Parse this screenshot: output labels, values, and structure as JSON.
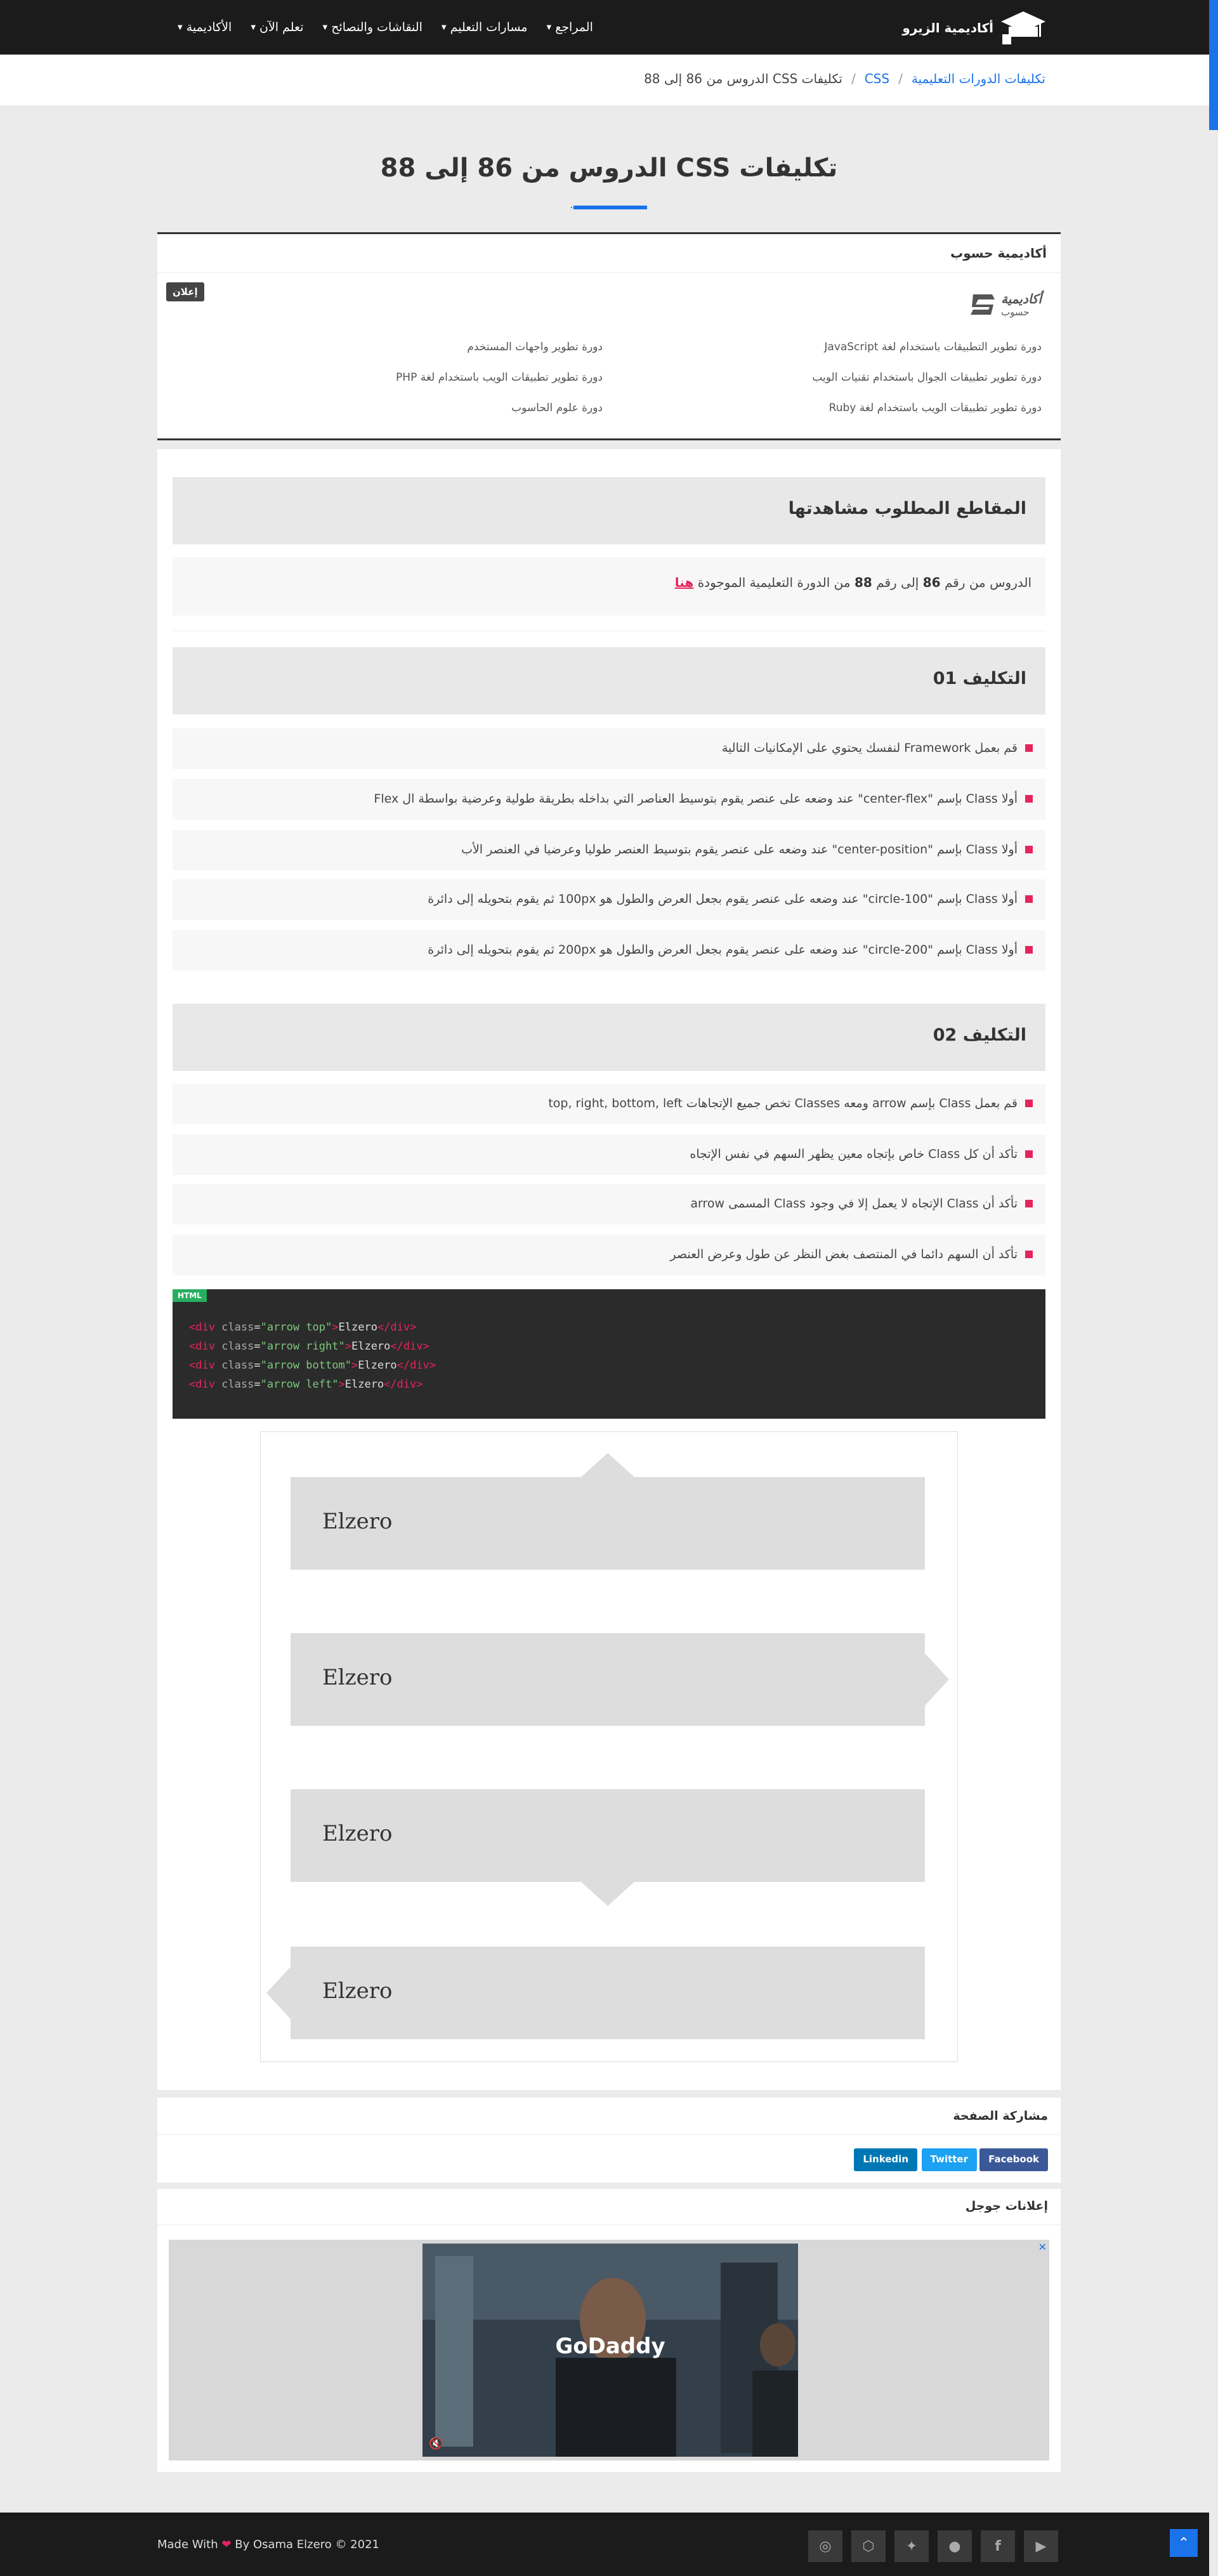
{
  "nav": {
    "logo": "أكاديمية الزيرو",
    "menu": [
      "الأكاديمية",
      "تعلم الآن",
      "النقاشات والنصائح",
      "مسارات التعليم",
      "المراجع"
    ]
  },
  "breadcrumb": {
    "root": "تكليفات الدورات التعليمية",
    "cat": "CSS",
    "current": "تكليفات CSS الدروس من 86 إلى 88"
  },
  "page_title": "تكليفات CSS الدروس من 86 إلى 88",
  "hasoub": {
    "title": "أكاديمية حسوب",
    "ad_label": "إعلان",
    "logo_main": "أكاديمية",
    "logo_sub": "حسوب",
    "courses": [
      "دورة تطوير التطبيقات باستخدام لغة JavaScript",
      "دورة تطوير واجهات المستخدم",
      "دورة تطوير تطبيقات الجوال باستخدام تقنيات الويب",
      "دورة تطوير تطبيقات الويب باستخدام لغة PHP",
      "دورة تطوير تطبيقات الويب باستخدام لغة Ruby",
      "دورة علوم الحاسوب"
    ]
  },
  "watch": {
    "title": "المقاطع المطلوب مشاهدتها",
    "text_a": "الدروس من رقم",
    "from": "86",
    "text_b": "إلى رقم",
    "to": "88",
    "text_c": "من الدورة التعليمية الموجودة",
    "link": "هنا"
  },
  "task1": {
    "title": "التكليف 01",
    "items": [
      "قم بعمل Framework لنفسك يحتوي على الإمكانيات التالية",
      "أولا Class بإسم \"center-flex\" عند وضعه على عنصر يقوم بتوسيط العناصر التي بداخله بطريقة طولية وعرضية بواسطة ال Flex",
      "أولا Class بإسم \"center-position\" عند وضعه على عنصر يقوم بتوسيط العنصر طوليا وعرضيا في العنصر الأب",
      "أولا Class بإسم \"circle-100\" عند وضعه على عنصر يقوم بجعل العرض والطول هو 100px ثم يقوم بتحويله إلى دائرة",
      "أولا Class بإسم \"circle-200\" عند وضعه على عنصر يقوم بجعل العرض والطول هو 200px ثم يقوم بتحويله إلى دائرة"
    ]
  },
  "task2": {
    "title": "التكليف 02",
    "items": [
      "قم بعمل Class بإسم arrow ومعه Classes تخص جميع الإتجاهات top, right, bottom, left",
      "تأكد أن كل Class خاص بإتجاه معين يظهر السهم في نفس الإتجاه",
      "تأكد أن Class الإتجاه لا يعمل إلا في وجود Class المسمى arrow",
      "تأكد أن السهم دائما في المنتصف بغض النظر عن طول وعرض العنصر"
    ]
  },
  "code": {
    "lang": "HTML",
    "lines": [
      {
        "cls": "arrow top",
        "text": "Elzero"
      },
      {
        "cls": "arrow right",
        "text": "Elzero"
      },
      {
        "cls": "arrow bottom",
        "text": "Elzero"
      },
      {
        "cls": "arrow left",
        "text": "Elzero"
      }
    ]
  },
  "demo": {
    "boxes": [
      {
        "label": "Elzero",
        "dir": "top"
      },
      {
        "label": "Elzero",
        "dir": "right"
      },
      {
        "label": "Elzero",
        "dir": "bottom"
      },
      {
        "label": "Elzero",
        "dir": "left"
      }
    ]
  },
  "share": {
    "title": "مشاركة الصفحة",
    "buttons": [
      {
        "label": "Facebook",
        "color": "#3b5998"
      },
      {
        "label": "Twitter",
        "color": "#1da1f2"
      },
      {
        "label": "Linkedin",
        "color": "#0077b5"
      }
    ]
  },
  "google_ads": {
    "title": "إعلانات جوجل",
    "video_brand": "GoDaddy",
    "close": "✕"
  },
  "footer": {
    "made_with": "Made With",
    "by": "By Osama Elzero © 2021",
    "social": [
      "youtube-icon",
      "facebook-icon",
      "github-icon",
      "twitter-icon",
      "codepen-icon",
      "instagram-icon"
    ]
  },
  "colors": {
    "accent": "#1a73e8",
    "pink": "#e6245c",
    "dark": "#1b1b1b"
  }
}
